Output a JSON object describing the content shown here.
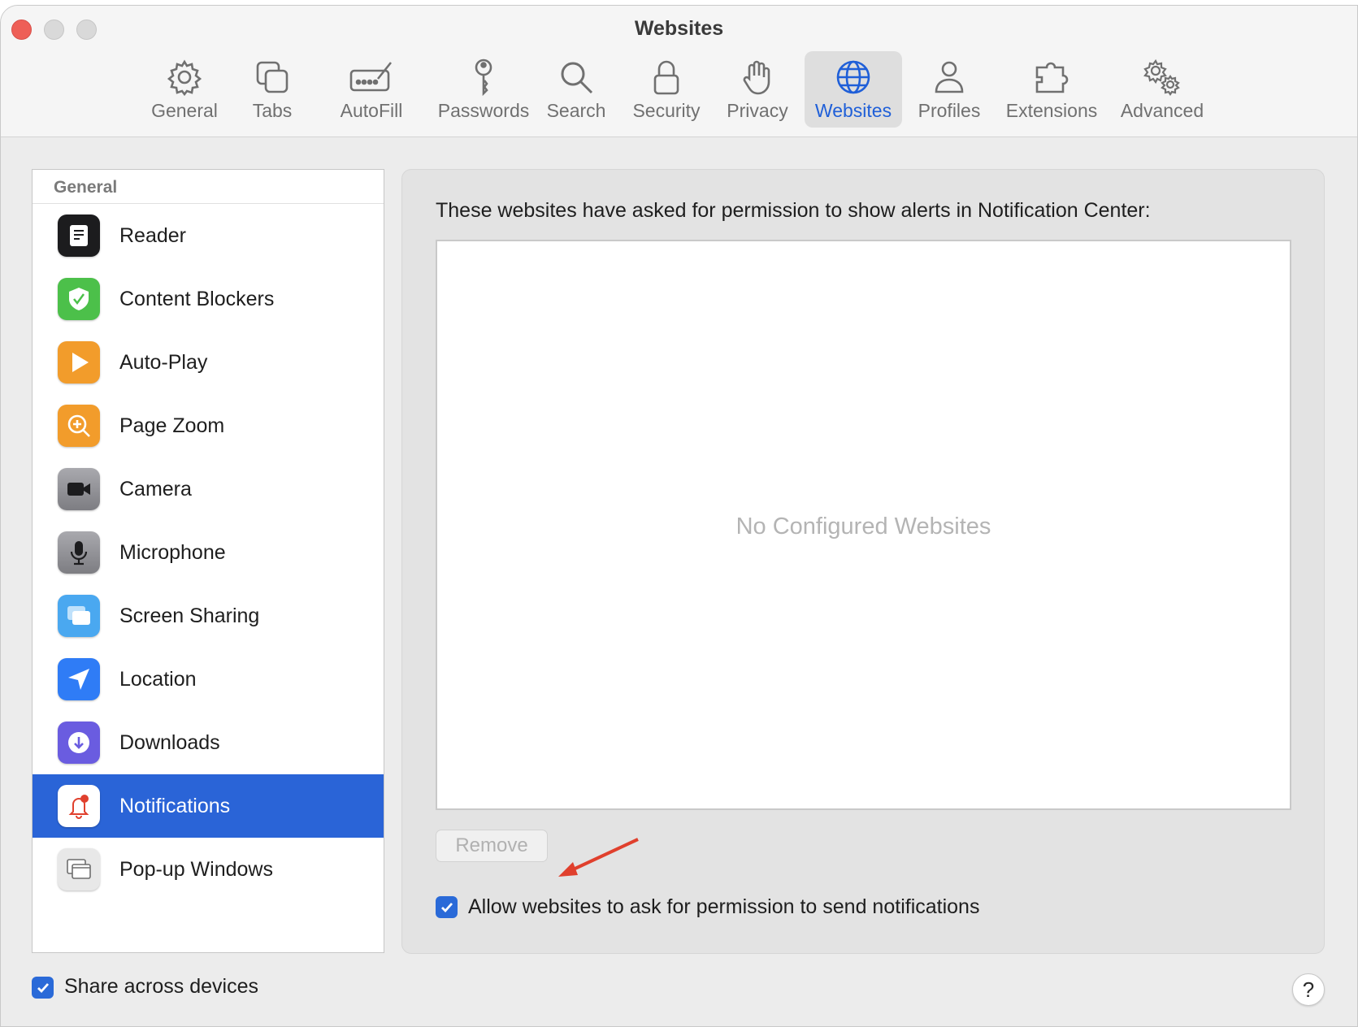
{
  "window": {
    "title": "Websites"
  },
  "toolbar": {
    "tabs": [
      {
        "label": "General",
        "icon": "gear-icon"
      },
      {
        "label": "Tabs",
        "icon": "tabs-icon"
      },
      {
        "label": "AutoFill",
        "icon": "autofill-icon"
      },
      {
        "label": "Passwords",
        "icon": "key-icon"
      },
      {
        "label": "Search",
        "icon": "search-icon"
      },
      {
        "label": "Security",
        "icon": "lock-icon"
      },
      {
        "label": "Privacy",
        "icon": "hand-icon"
      },
      {
        "label": "Websites",
        "icon": "globe-icon",
        "active": true
      },
      {
        "label": "Profiles",
        "icon": "person-icon"
      },
      {
        "label": "Extensions",
        "icon": "puzzle-icon"
      },
      {
        "label": "Advanced",
        "icon": "gears-icon"
      }
    ],
    "active_color": "#1f5fd8"
  },
  "sidebar": {
    "header": "General",
    "items": [
      {
        "label": "Reader",
        "icon": "reader-icon",
        "color": "#1c1c1e"
      },
      {
        "label": "Content Blockers",
        "icon": "shield-check-icon",
        "color": "#4cc04a"
      },
      {
        "label": "Auto-Play",
        "icon": "play-icon",
        "color": "#f29c2b"
      },
      {
        "label": "Page Zoom",
        "icon": "zoom-icon",
        "color": "#f29c2b"
      },
      {
        "label": "Camera",
        "icon": "camera-icon",
        "color": "#8e8e93"
      },
      {
        "label": "Microphone",
        "icon": "microphone-icon",
        "color": "#8e8e93"
      },
      {
        "label": "Screen Sharing",
        "icon": "screen-sharing-icon",
        "color": "#4aa8f0"
      },
      {
        "label": "Location",
        "icon": "location-arrow-icon",
        "color": "#2f7cf6"
      },
      {
        "label": "Downloads",
        "icon": "download-icon",
        "color": "#6a5ce0"
      },
      {
        "label": "Notifications",
        "icon": "bell-icon",
        "color": "#ffffff",
        "selected": true
      },
      {
        "label": "Pop-up Windows",
        "icon": "popup-windows-icon",
        "color": "#e8e8e8"
      }
    ],
    "selected_color": "#2a64d7"
  },
  "panel": {
    "heading": "These websites have asked for permission to show alerts in Notification Center:",
    "empty_message": "No Configured Websites",
    "remove_label": "Remove",
    "allow_label": "Allow websites to ask for permission to send notifications",
    "allow_checked": true
  },
  "footer": {
    "share_label": "Share across devices",
    "share_checked": true,
    "help_label": "?"
  },
  "annotation": {
    "arrow_color": "#e0402d"
  }
}
